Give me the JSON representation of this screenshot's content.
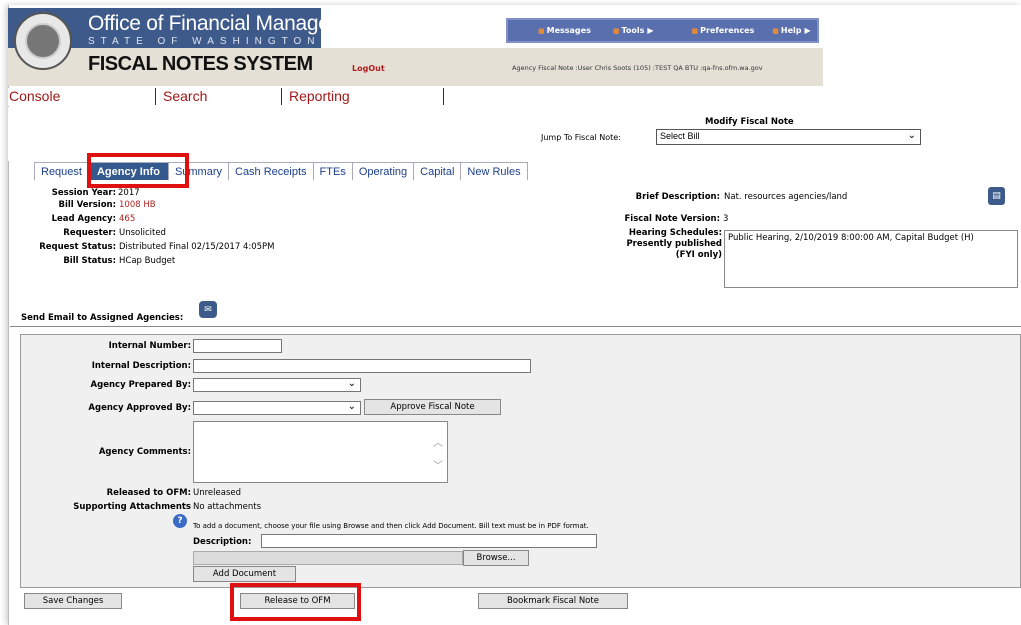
{
  "header": {
    "org_title": "Office of Financial Management",
    "org_subtitle": "STATE OF WASHINGTON",
    "system_title": "FISCAL NOTES SYSTEM",
    "logout": "LogOut",
    "agency_note": "Agency Fiscal Note :User Chris Soots (105) :TEST QA BTU :qa-fns.ofm.wa.gov"
  },
  "top_menu": [
    {
      "label": "Messages",
      "has_arrow": false
    },
    {
      "label": "Tools",
      "has_arrow": true
    },
    {
      "label": "Preferences",
      "has_arrow": false
    },
    {
      "label": "Help",
      "has_arrow": true
    }
  ],
  "nav": {
    "console": "Console",
    "search": "Search",
    "reporting": "Reporting"
  },
  "page": {
    "heading": "Modify Fiscal Note",
    "jump_label": "Jump To Fiscal Note:",
    "jump_value": "Select Bill"
  },
  "tabs": [
    "Request",
    "Agency Info",
    "Summary",
    "Cash Receipts",
    "FTEs",
    "Operating",
    "Capital",
    "New Rules"
  ],
  "active_tab": "Agency Info",
  "info_left": {
    "session_label": "Session Year:",
    "session_value": "2017",
    "bill_version_label": "Bill Version:",
    "bill_version_value": "1008 HB",
    "lead_agency_label": "Lead Agency:",
    "lead_agency_value": "465",
    "requester_label": "Requester:",
    "requester_value": "Unsolicited",
    "request_status_label": "Request Status:",
    "request_status_value": "Distributed Final 02/15/2017 4:05PM",
    "bill_status_label": "Bill Status:",
    "bill_status_value": "HCap Budget"
  },
  "info_right": {
    "brief_desc_label": "Brief Description:",
    "brief_desc_value": "Nat. resources agencies/land",
    "fn_version_label": "Fiscal Note Version:",
    "fn_version_value": "3",
    "hearing_label_1": "Hearing Schedules:",
    "hearing_label_2": "Presently published",
    "hearing_label_3": "(FYI only)",
    "hearing_value": "Public Hearing, 2/10/2019 8:00:00 AM, Capital Budget (H)"
  },
  "email_label": "Send Email to Assigned Agencies:",
  "form": {
    "internal_number_label": "Internal Number:",
    "internal_number_value": "",
    "internal_desc_label": "Internal Description:",
    "internal_desc_value": "",
    "prepared_by_label": "Agency Prepared By:",
    "prepared_by_value": "",
    "approved_by_label": "Agency Approved By:",
    "approved_by_value": "",
    "approve_button": "Approve Fiscal Note",
    "comments_label": "Agency Comments:",
    "comments_value": "",
    "released_label": "Released to OFM:",
    "released_value": "Unreleased",
    "attachments_label": "Supporting Attachments",
    "attachments_value": "No attachments",
    "add_doc_hint": "To add a document, choose your file using Browse and then click Add Document. Bill text must be in PDF format.",
    "description_label": "Description:",
    "description_value": "",
    "browse_button": "Browse...",
    "add_document_button": "Add Document"
  },
  "bottom_buttons": {
    "save": "Save Changes",
    "release": "Release to OFM",
    "bookmark": "Bookmark Fiscal Note"
  },
  "colors": {
    "header_blue": "#3e5a8a",
    "tab_active": "#34598f",
    "nav_red": "#a01818",
    "highlight_red": "#e01010"
  }
}
